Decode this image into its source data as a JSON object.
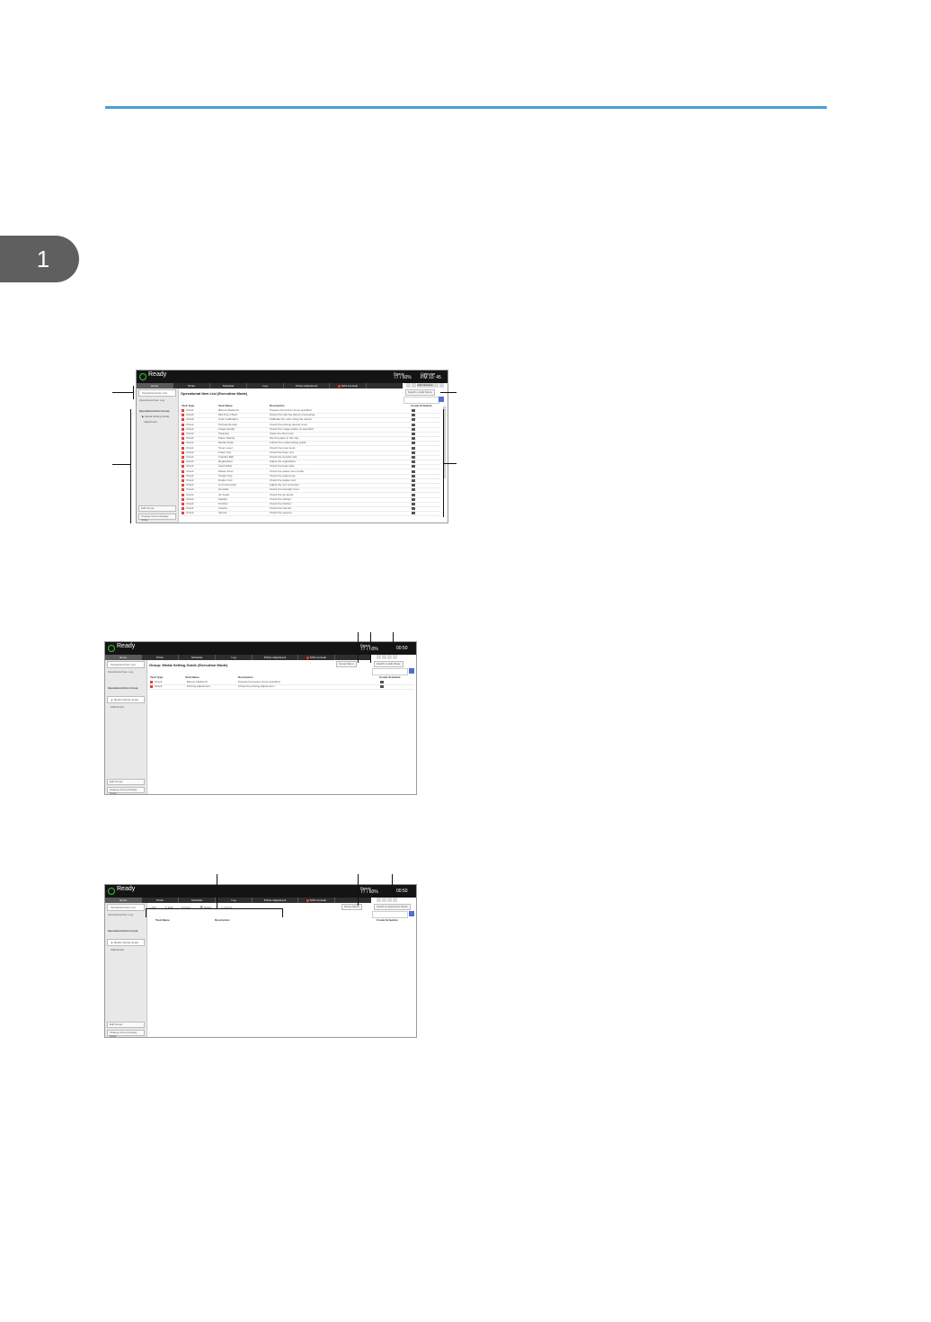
{
  "chapter_number": "1",
  "screens": [
    {
      "ready": "Ready",
      "status1": "Ready",
      "status1_value": "77 / 60%",
      "status2": "Calendar",
      "status2_value": "PM 10: 45",
      "tabs": [
        "Home",
        "Prints",
        "Schedule",
        "Log",
        "Printer Adjustment",
        "SOS Console"
      ],
      "sidebar_items": [
        "Operational Item List",
        "Operational Item Log"
      ],
      "sidebar_head": "Operational Item Group",
      "sidebar_sub": [
        "Media Setting Guide",
        "Adjustment"
      ],
      "sidebar_bottom": [
        "Edit Group",
        "Change Group Display Order"
      ],
      "title": "Operational Item List (Execution Mode)",
      "edit_button": "Switch to Edit Mode",
      "user_label": "Administrator",
      "headers": [
        "Task Type",
        "Task Name",
        "Description",
        "Create Schedule"
      ],
      "rows": [
        [
          "Check",
          "Banner Media Kit",
          "Prepare the banner kit as specified."
        ],
        [
          "Check",
          "Mid-Tray Check",
          "Check the mid-tray before proceeding."
        ],
        [
          "Check",
          "Color Calibration",
          "Calibrate the color using the sensor."
        ],
        [
          "Check",
          "Printing Density",
          "Check the printing density level."
        ],
        [
          "Check",
          "Image Quality",
          "Check the image quality as specified."
        ],
        [
          "Check",
          "Cleaning",
          "Clean the drum unit."
        ],
        [
          "Check",
          "Paper Setting",
          "Set the paper in the tray."
        ],
        [
          "Check",
          "Media Guide",
          "Follow the media setting guide."
        ],
        [
          "Check",
          "Toner Level",
          "Check the toner level."
        ],
        [
          "Check",
          "Fuser Unit",
          "Check the fuser unit."
        ],
        [
          "Check",
          "Transfer Belt",
          "Check the transfer belt."
        ],
        [
          "Check",
          "Registration",
          "Adjust the registration."
        ],
        [
          "Check",
          "Feed Roller",
          "Check the feed roller."
        ],
        [
          "Check",
          "Waste Toner",
          "Check the waste toner bottle."
        ],
        [
          "Check",
          "Output Tray",
          "Check the output tray."
        ],
        [
          "Check",
          "Duplex Unit",
          "Check the duplex unit."
        ],
        [
          "Check",
          "Curl Correction",
          "Adjust the curl correction."
        ],
        [
          "Check",
          "Humidity",
          "Check the humidity level."
        ],
        [
          "Check",
          "Air Assist",
          "Check the air assist."
        ],
        [
          "Check",
          "Stacker",
          "Check the stacker."
        ],
        [
          "Check",
          "Finisher",
          "Check the finisher."
        ],
        [
          "Check",
          "Inserter",
          "Check the inserter."
        ],
        [
          "Check",
          "Sensor",
          "Check the sensors."
        ]
      ]
    },
    {
      "ready": "Ready",
      "status1": "Ready",
      "status1_value": "77 / 60%",
      "status2_value": "00:50",
      "tabs": [
        "Home",
        "Prints",
        "Schedule",
        "Log",
        "Printer Adjustment",
        "SOS Console"
      ],
      "sidebar_items": [
        "Operational Item List",
        "Operational Item Log"
      ],
      "sidebar_head": "Operational Item Group",
      "sidebar_sub": [
        "Media Setting Guide",
        "Adjustment"
      ],
      "sidebar_bottom": [
        "Edit Group",
        "Change Group Display Order"
      ],
      "title": "Group: Media Setting Guide (Execution Mode)",
      "group_button": "Group Menu",
      "edit_button": "Switch to Edit Mode",
      "headers": [
        "Task Type",
        "Task Name",
        "Description",
        "Create Schedule"
      ],
      "rows": [
        [
          "Check",
          "Banner Media Kit",
          "Prepare the banner kit as specified."
        ],
        [
          "Check",
          "Printing Adjustment",
          "Check the printing adjustment."
        ]
      ]
    },
    {
      "ready": "Ready",
      "status1": "Ready",
      "status1_value": "77 / 60%",
      "status2_value": "00:50",
      "tabs": [
        "Home",
        "Prints",
        "Schedule",
        "Log",
        "Printer Adjustment",
        "SOS Console"
      ],
      "sidebar_items": [
        "Operational Item List",
        "Operational Item Log"
      ],
      "sidebar_head": "Operational Item Group",
      "sidebar_sub": [
        "Media Setting Guide",
        "Adjustment"
      ],
      "sidebar_bottom": [
        "Edit Group",
        "Change Group Display Order"
      ],
      "toolbar": [
        "Add",
        "Edit",
        "Copy",
        "Delete",
        "Import"
      ],
      "group_button": "Group Menu",
      "edit_button": "Switch to Execution Mode",
      "headers": [
        "Task Name",
        "Description",
        "Create Schedule"
      ]
    }
  ]
}
